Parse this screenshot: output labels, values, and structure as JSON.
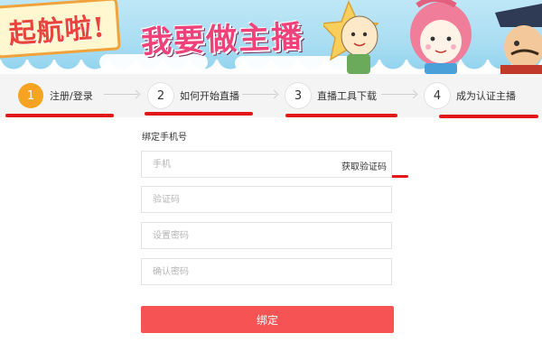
{
  "banner": {
    "flag_text": "起航啦!",
    "slogan": "我要做主播"
  },
  "steps": [
    {
      "number": "1",
      "label": "注册/登录",
      "active": true
    },
    {
      "number": "2",
      "label": "如何开始直播",
      "active": false
    },
    {
      "number": "3",
      "label": "直播工具下载",
      "active": false
    },
    {
      "number": "4",
      "label": "成为认证主播",
      "active": false
    }
  ],
  "form": {
    "title": "绑定手机号",
    "phone": {
      "placeholder": "手机",
      "value": ""
    },
    "get_code_label": "获取验证码",
    "code": {
      "placeholder": "验证码",
      "value": ""
    },
    "password": {
      "placeholder": "设置密码",
      "value": ""
    },
    "confirm_password": {
      "placeholder": "确认密码",
      "value": ""
    },
    "submit_label": "绑定"
  },
  "colors": {
    "active_step": "#f5a321",
    "submit_button": "#f65354",
    "annotation_marks": "#e21818",
    "banner_sky": "#a9ddf2"
  }
}
